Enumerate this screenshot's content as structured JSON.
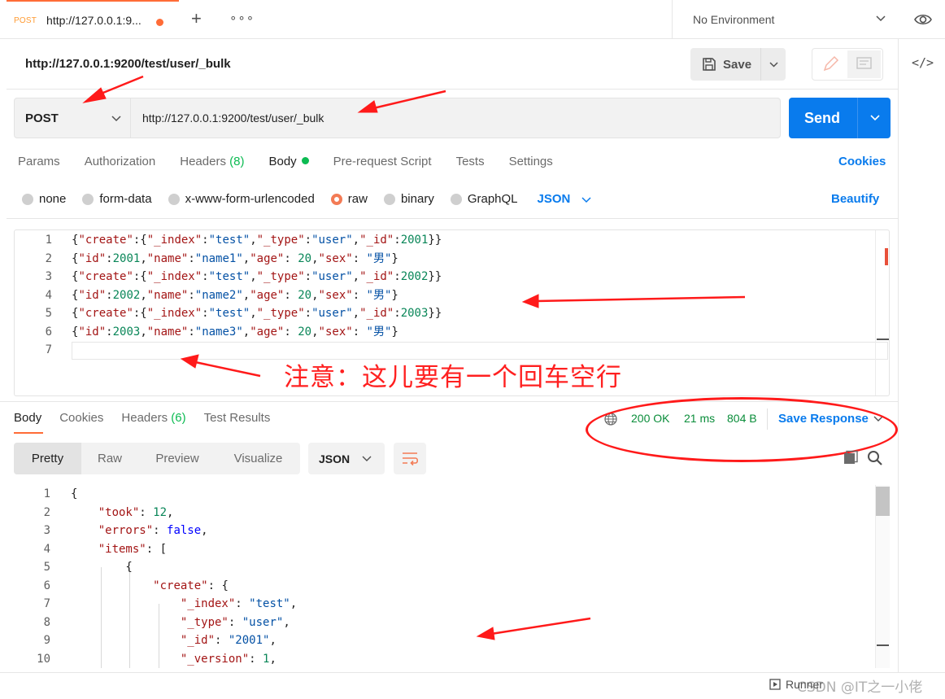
{
  "tabs": {
    "active": {
      "method": "POST",
      "title": "http://127.0.0.1:9..."
    },
    "plus": "+",
    "more": "∘∘∘"
  },
  "environment": {
    "label": "No Environment"
  },
  "request": {
    "name": "http://127.0.0.1:9200/test/user/_bulk",
    "save_label": "Save",
    "method": "POST",
    "url": "http://127.0.0.1:9200/test/user/_bulk",
    "send_label": "Send"
  },
  "request_tabs": [
    {
      "label": "Params"
    },
    {
      "label": "Authorization"
    },
    {
      "label": "Headers",
      "count": "(8)"
    },
    {
      "label": "Body"
    },
    {
      "label": "Pre-request Script"
    },
    {
      "label": "Tests"
    },
    {
      "label": "Settings"
    }
  ],
  "cookies_label": "Cookies",
  "body_types": [
    {
      "label": "none"
    },
    {
      "label": "form-data"
    },
    {
      "label": "x-www-form-urlencoded"
    },
    {
      "label": "raw",
      "selected": true
    },
    {
      "label": "binary"
    },
    {
      "label": "GraphQL"
    }
  ],
  "body_format": "JSON",
  "beautify_label": "Beautify",
  "request_body": [
    {
      "num": "1",
      "line": [
        [
          "p",
          "{"
        ],
        [
          "k",
          "\"create\""
        ],
        [
          "p",
          ":{"
        ],
        [
          "k",
          "\"_index\""
        ],
        [
          "p",
          ":"
        ],
        [
          "s",
          "\"test\""
        ],
        [
          "p",
          ","
        ],
        [
          "k",
          "\"_type\""
        ],
        [
          "p",
          ":"
        ],
        [
          "s",
          "\"user\""
        ],
        [
          "p",
          ","
        ],
        [
          "k",
          "\"_id\""
        ],
        [
          "p",
          ":"
        ],
        [
          "n",
          "2001"
        ],
        [
          "p",
          "}}"
        ]
      ]
    },
    {
      "num": "2",
      "line": [
        [
          "p",
          "{"
        ],
        [
          "k",
          "\"id\""
        ],
        [
          "p",
          ":"
        ],
        [
          "n",
          "2001"
        ],
        [
          "p",
          ","
        ],
        [
          "k",
          "\"name\""
        ],
        [
          "p",
          ":"
        ],
        [
          "s",
          "\"name1\""
        ],
        [
          "p",
          ","
        ],
        [
          "k",
          "\"age\""
        ],
        [
          "p",
          ": "
        ],
        [
          "n",
          "20"
        ],
        [
          "p",
          ","
        ],
        [
          "k",
          "\"sex\""
        ],
        [
          "p",
          ": "
        ],
        [
          "s",
          "\"男\""
        ],
        [
          "p",
          "}"
        ]
      ]
    },
    {
      "num": "3",
      "line": [
        [
          "p",
          "{"
        ],
        [
          "k",
          "\"create\""
        ],
        [
          "p",
          ":{"
        ],
        [
          "k",
          "\"_index\""
        ],
        [
          "p",
          ":"
        ],
        [
          "s",
          "\"test\""
        ],
        [
          "p",
          ","
        ],
        [
          "k",
          "\"_type\""
        ],
        [
          "p",
          ":"
        ],
        [
          "s",
          "\"user\""
        ],
        [
          "p",
          ","
        ],
        [
          "k",
          "\"_id\""
        ],
        [
          "p",
          ":"
        ],
        [
          "n",
          "2002"
        ],
        [
          "p",
          "}}"
        ]
      ]
    },
    {
      "num": "4",
      "line": [
        [
          "p",
          "{"
        ],
        [
          "k",
          "\"id\""
        ],
        [
          "p",
          ":"
        ],
        [
          "n",
          "2002"
        ],
        [
          "p",
          ","
        ],
        [
          "k",
          "\"name\""
        ],
        [
          "p",
          ":"
        ],
        [
          "s",
          "\"name2\""
        ],
        [
          "p",
          ","
        ],
        [
          "k",
          "\"age\""
        ],
        [
          "p",
          ": "
        ],
        [
          "n",
          "20"
        ],
        [
          "p",
          ","
        ],
        [
          "k",
          "\"sex\""
        ],
        [
          "p",
          ": "
        ],
        [
          "s",
          "\"男\""
        ],
        [
          "p",
          "}"
        ]
      ]
    },
    {
      "num": "5",
      "line": [
        [
          "p",
          "{"
        ],
        [
          "k",
          "\"create\""
        ],
        [
          "p",
          ":{"
        ],
        [
          "k",
          "\"_index\""
        ],
        [
          "p",
          ":"
        ],
        [
          "s",
          "\"test\""
        ],
        [
          "p",
          ","
        ],
        [
          "k",
          "\"_type\""
        ],
        [
          "p",
          ":"
        ],
        [
          "s",
          "\"user\""
        ],
        [
          "p",
          ","
        ],
        [
          "k",
          "\"_id\""
        ],
        [
          "p",
          ":"
        ],
        [
          "n",
          "2003"
        ],
        [
          "p",
          "}}"
        ]
      ]
    },
    {
      "num": "6",
      "line": [
        [
          "p",
          "{"
        ],
        [
          "k",
          "\"id\""
        ],
        [
          "p",
          ":"
        ],
        [
          "n",
          "2003"
        ],
        [
          "p",
          ","
        ],
        [
          "k",
          "\"name\""
        ],
        [
          "p",
          ":"
        ],
        [
          "s",
          "\"name3\""
        ],
        [
          "p",
          ","
        ],
        [
          "k",
          "\"age\""
        ],
        [
          "p",
          ": "
        ],
        [
          "n",
          "20"
        ],
        [
          "p",
          ","
        ],
        [
          "k",
          "\"sex\""
        ],
        [
          "p",
          ": "
        ],
        [
          "s",
          "\"男\""
        ],
        [
          "p",
          "}"
        ]
      ]
    },
    {
      "num": "7",
      "line": []
    }
  ],
  "annotation": "注意：这儿要有一个回车空行",
  "response_tabs": [
    {
      "label": "Body"
    },
    {
      "label": "Cookies"
    },
    {
      "label": "Headers",
      "count": "(6)"
    },
    {
      "label": "Test Results"
    }
  ],
  "response_meta": {
    "status": "200 OK",
    "time": "21 ms",
    "size": "804 B",
    "save_response": "Save Response"
  },
  "response_formats": [
    {
      "label": "Pretty"
    },
    {
      "label": "Raw"
    },
    {
      "label": "Preview"
    },
    {
      "label": "Visualize"
    }
  ],
  "response_format_type": "JSON",
  "response_body": [
    {
      "num": "1",
      "line": [
        [
          "p",
          "{"
        ]
      ]
    },
    {
      "num": "2",
      "line": [
        [
          "p",
          "    "
        ],
        [
          "k",
          "\"took\""
        ],
        [
          "p",
          ": "
        ],
        [
          "n",
          "12"
        ],
        [
          "p",
          ","
        ]
      ]
    },
    {
      "num": "3",
      "line": [
        [
          "p",
          "    "
        ],
        [
          "k",
          "\"errors\""
        ],
        [
          "p",
          ": "
        ],
        [
          "b",
          "false"
        ],
        [
          "p",
          ","
        ]
      ]
    },
    {
      "num": "4",
      "line": [
        [
          "p",
          "    "
        ],
        [
          "k",
          "\"items\""
        ],
        [
          "p",
          ": ["
        ]
      ]
    },
    {
      "num": "5",
      "line": [
        [
          "p",
          "        {"
        ]
      ]
    },
    {
      "num": "6",
      "line": [
        [
          "p",
          "            "
        ],
        [
          "k",
          "\"create\""
        ],
        [
          "p",
          ": {"
        ]
      ]
    },
    {
      "num": "7",
      "line": [
        [
          "p",
          "                "
        ],
        [
          "k",
          "\"_index\""
        ],
        [
          "p",
          ": "
        ],
        [
          "s",
          "\"test\""
        ],
        [
          "p",
          ","
        ]
      ]
    },
    {
      "num": "8",
      "line": [
        [
          "p",
          "                "
        ],
        [
          "k",
          "\"_type\""
        ],
        [
          "p",
          ": "
        ],
        [
          "s",
          "\"user\""
        ],
        [
          "p",
          ","
        ]
      ]
    },
    {
      "num": "9",
      "line": [
        [
          "p",
          "                "
        ],
        [
          "k",
          "\"_id\""
        ],
        [
          "p",
          ": "
        ],
        [
          "s",
          "\"2001\""
        ],
        [
          "p",
          ","
        ]
      ]
    },
    {
      "num": "10",
      "line": [
        [
          "p",
          "                "
        ],
        [
          "k",
          "\"_version\""
        ],
        [
          "p",
          ": "
        ],
        [
          "n",
          "1"
        ],
        [
          "p",
          ","
        ]
      ]
    }
  ],
  "footer": {
    "runner": "Runner",
    "watermark": "CSDN @IT之一小佬"
  }
}
